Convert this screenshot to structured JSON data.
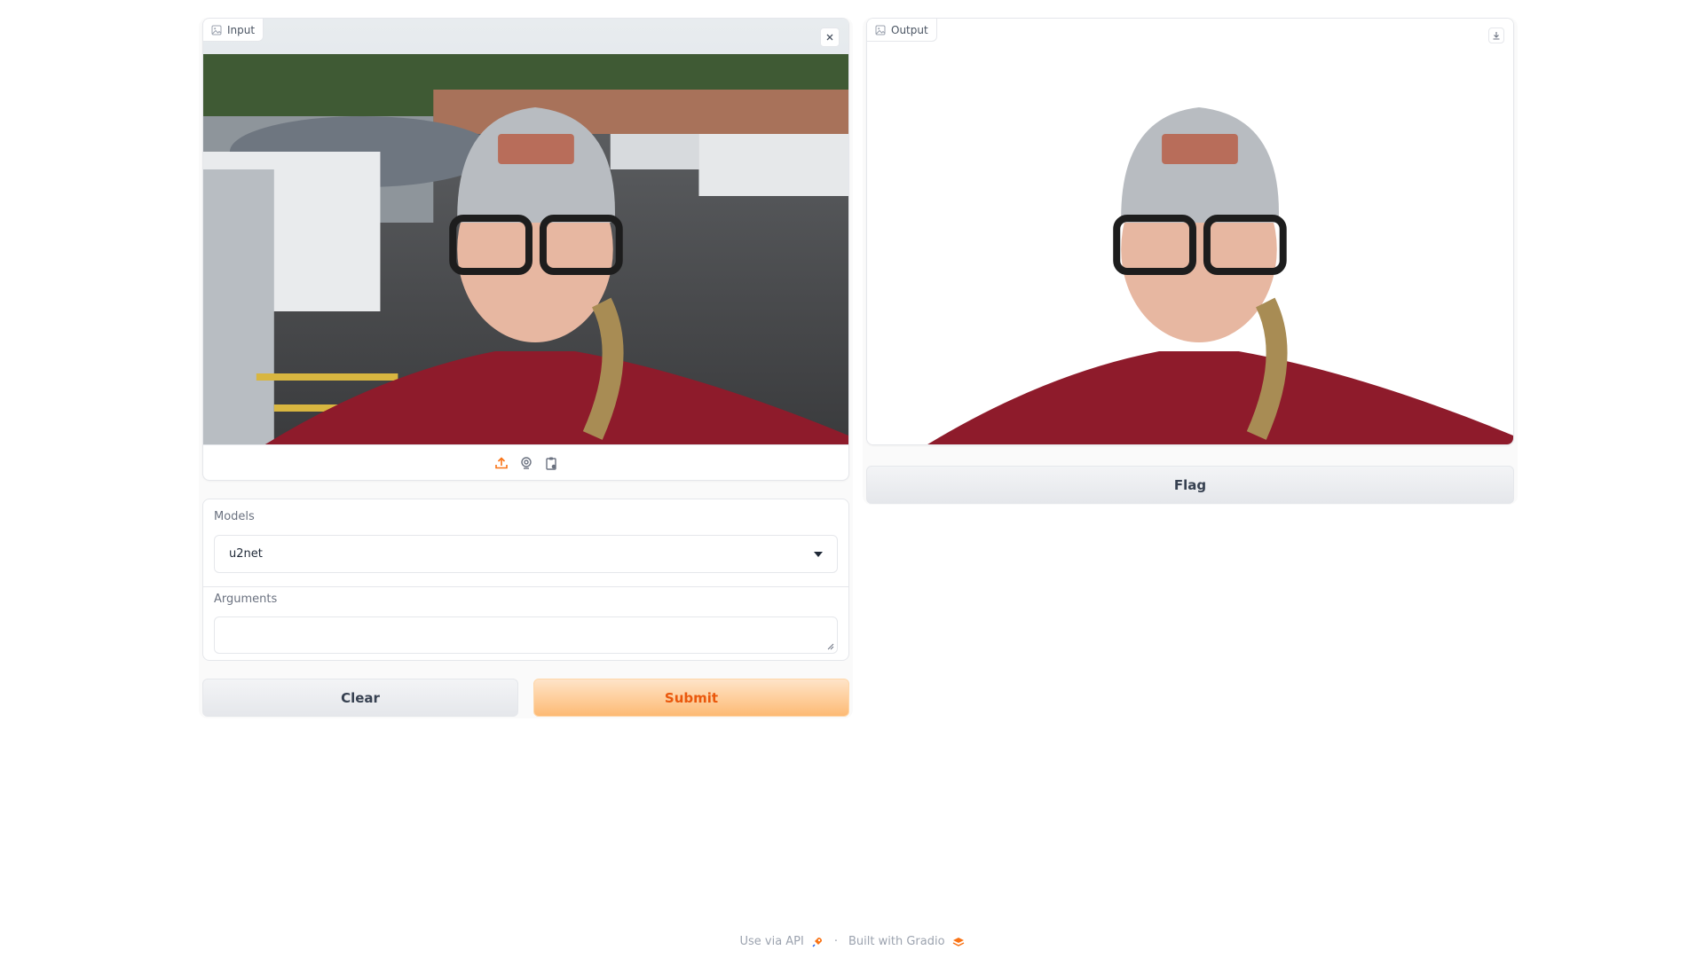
{
  "input": {
    "label": "Input",
    "source_icons": [
      "upload-icon",
      "webcam-icon",
      "clipboard-icon"
    ]
  },
  "models": {
    "label": "Models",
    "selected": "u2net"
  },
  "arguments": {
    "label": "Arguments",
    "value": ""
  },
  "buttons": {
    "clear": "Clear",
    "submit": "Submit",
    "flag": "Flag"
  },
  "output": {
    "label": "Output"
  },
  "footer": {
    "api": "Use via API",
    "separator": "·",
    "built": "Built with Gradio"
  },
  "colors": {
    "accent": "#f97316",
    "submit_bg": "#fdba74",
    "border": "#e5e7eb"
  }
}
